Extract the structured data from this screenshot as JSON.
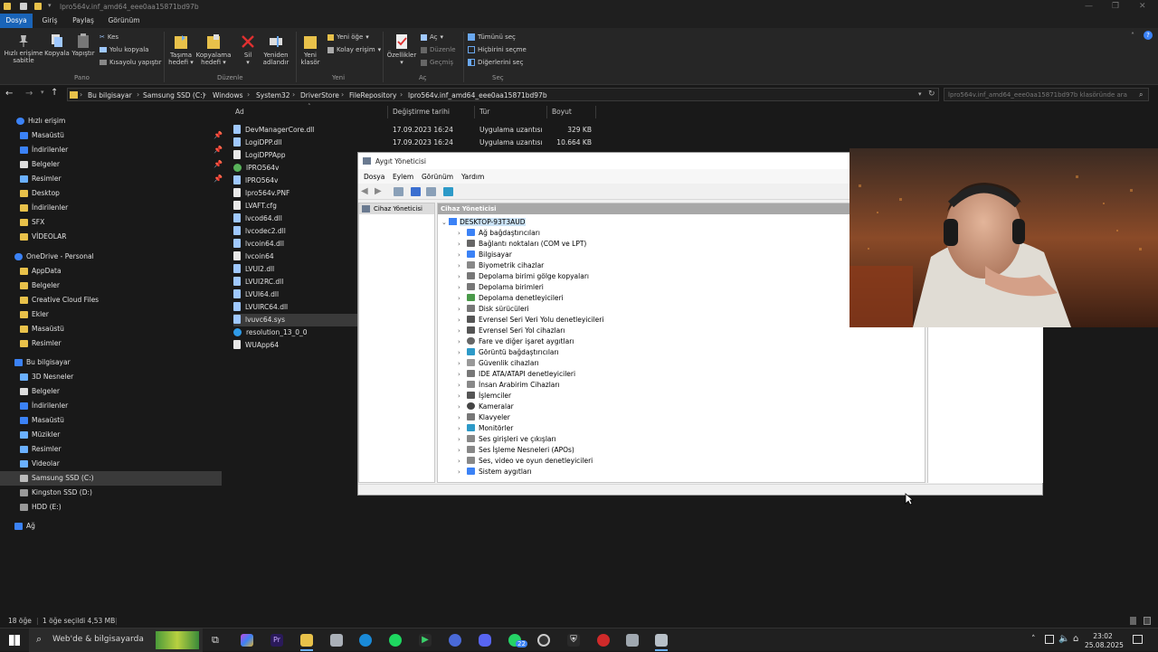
{
  "window": {
    "title": "lpro564v.inf_amd64_eee0aa15871bd97b"
  },
  "ribbon_tabs": [
    "Dosya",
    "Giriş",
    "Paylaş",
    "Görünüm"
  ],
  "ribbon": {
    "pano": {
      "pin_label_1": "Hızlı erişime",
      "pin_label_2": "sabitle",
      "copy": "Kopyala",
      "paste": "Yapıştır",
      "cut": "Kes",
      "copy_path": "Yolu kopyala",
      "paste_shortcut": "Kısayolu yapıştır",
      "group": "Pano"
    },
    "duzenle": {
      "move_1": "Taşıma",
      "move_2": "hedefi",
      "copyto_1": "Kopyalama",
      "copyto_2": "hedefi",
      "delete": "Sil",
      "rename_1": "Yeniden",
      "rename_2": "adlandır",
      "group": "Düzenle"
    },
    "yeni": {
      "newfolder_1": "Yeni",
      "newfolder_2": "klasör",
      "new_item": "Yeni öğe",
      "easy_access": "Kolay erişim",
      "group": "Yeni"
    },
    "ac": {
      "properties": "Özellikler",
      "open": "Aç",
      "edit": "Düzenle",
      "history": "Geçmiş",
      "group": "Aç"
    },
    "sec": {
      "select_all": "Tümünü seç",
      "select_none": "Hiçbirini seçme",
      "invert": "Diğerlerini seç",
      "group": "Seç"
    }
  },
  "address": {
    "crumbs": [
      "Bu bilgisayar",
      "Samsung SSD (C:)",
      "Windows",
      "System32",
      "DriverStore",
      "FileRepository",
      "lpro564v.inf_amd64_eee0aa15871bd97b"
    ],
    "search_placeholder": "lpro564v.inf_amd64_eee0aa15871bd97b klasöründe ara"
  },
  "nav": {
    "quick_access": "Hızlı erişim",
    "quick_items": [
      "Masaüstü",
      "İndirilenler",
      "Belgeler",
      "Resimler",
      "Desktop",
      "İndirilenler",
      "SFX",
      "VİDEOLAR"
    ],
    "onedrive": "OneDrive - Personal",
    "onedrive_items": [
      "AppData",
      "Belgeler",
      "Creative Cloud Files",
      "Ekler",
      "Masaüstü",
      "Resimler"
    ],
    "this_pc": "Bu bilgisayar",
    "pc_items": [
      "3D Nesneler",
      "Belgeler",
      "İndirilenler",
      "Masaüstü",
      "Müzikler",
      "Resimler",
      "Videolar",
      "Samsung SSD (C:)",
      "Kingston SSD (D:)",
      "HDD (E:)"
    ],
    "network": "Ağ"
  },
  "columns": {
    "name": "Ad",
    "date": "Değiştirme tarihi",
    "type": "Tür",
    "size": "Boyut"
  },
  "files": [
    {
      "name": "DevManagerCore.dll",
      "date": "17.09.2023 16:24",
      "type": "Uygulama uzantısı",
      "size": "329 KB"
    },
    {
      "name": "LogiDPP.dll",
      "date": "17.09.2023 16:24",
      "type": "Uygulama uzantısı",
      "size": "10.664 KB"
    },
    {
      "name": "LogiDPPApp",
      "date": "",
      "type": "",
      "size": ""
    },
    {
      "name": "lPRO564v",
      "date": "",
      "type": "",
      "size": ""
    },
    {
      "name": "lPRO564v",
      "date": "",
      "type": "",
      "size": ""
    },
    {
      "name": "lpro564v.PNF",
      "date": "",
      "type": "",
      "size": ""
    },
    {
      "name": "LVAFT.cfg",
      "date": "",
      "type": "",
      "size": ""
    },
    {
      "name": "lvcod64.dll",
      "date": "",
      "type": "",
      "size": ""
    },
    {
      "name": "lvcodec2.dll",
      "date": "",
      "type": "",
      "size": ""
    },
    {
      "name": "lvcoin64.dll",
      "date": "",
      "type": "",
      "size": ""
    },
    {
      "name": "lvcoin64",
      "date": "",
      "type": "",
      "size": ""
    },
    {
      "name": "LVUI2.dll",
      "date": "",
      "type": "",
      "size": ""
    },
    {
      "name": "LVUI2RC.dll",
      "date": "",
      "type": "",
      "size": ""
    },
    {
      "name": "LVUI64.dll",
      "date": "",
      "type": "",
      "size": ""
    },
    {
      "name": "LVUIRC64.dll",
      "date": "",
      "type": "",
      "size": ""
    },
    {
      "name": "lvuvc64.sys",
      "date": "",
      "type": "",
      "size": ""
    },
    {
      "name": "resolution_13_0_0",
      "date": "",
      "type": "",
      "size": ""
    },
    {
      "name": "WUApp64",
      "date": "",
      "type": "",
      "size": ""
    }
  ],
  "status": {
    "count": "18 öğe",
    "selected": "1 öğe seçildi  4,53 MB"
  },
  "device_manager": {
    "title": "Aygıt Yöneticisi",
    "menu": [
      "Dosya",
      "Eylem",
      "Görünüm",
      "Yardım"
    ],
    "left_header": "Cihaz Yöneticisi",
    "right_header": "Cihaz Yöneticisi",
    "root": "DESKTOP-93T3AUD",
    "nodes": [
      "Ağ bağdaştırıcıları",
      "Bağlantı noktaları (COM ve LPT)",
      "Bilgisayar",
      "Biyometrik cihazlar",
      "Depolama birimi gölge kopyaları",
      "Depolama birimleri",
      "Depolama denetleyicileri",
      "Disk sürücüleri",
      "Evrensel Seri Veri Yolu denetleyicileri",
      "Evrensel Seri Yol cihazları",
      "Fare ve diğer işaret aygıtları",
      "Görüntü bağdaştırıcıları",
      "Güvenlik cihazları",
      "IDE ATA/ATAPI denetleyicileri",
      "İnsan Arabirim Cihazları",
      "İşlemciler",
      "Kameralar",
      "Klavyeler",
      "Monitörler",
      "Ses girişleri ve çıkışları",
      "Ses İşleme Nesneleri (APOs)",
      "Ses, video ve oyun denetleyicileri",
      "Sistem aygıtları"
    ]
  },
  "taskbar": {
    "search": "Web'de & bilgisayarda",
    "badge": "22",
    "time": "23:02",
    "date": "25.08.2025"
  },
  "colors": {
    "accent": "#1a64b8",
    "folder": "#e8c14a",
    "explorer_bg": "#191919"
  }
}
